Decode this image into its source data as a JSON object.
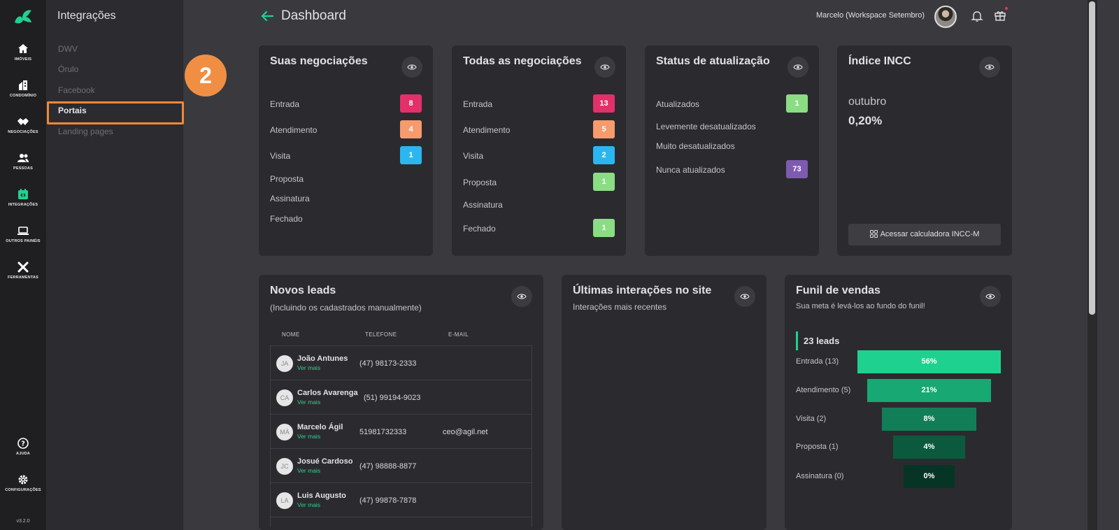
{
  "rail": {
    "items": [
      {
        "label": "IMÓVEIS",
        "icon": "home-icon"
      },
      {
        "label": "CONDOMÍNIO",
        "icon": "building-icon"
      },
      {
        "label": "NEGOCIAÇÕES",
        "icon": "handshake-icon"
      },
      {
        "label": "PESSOAS",
        "icon": "people-icon"
      },
      {
        "label": "INTEGRAÇÕES",
        "icon": "integrations-icon"
      },
      {
        "label": "OUTROS PAINÉIS",
        "icon": "laptop-icon"
      },
      {
        "label": "FERRAMENTAS",
        "icon": "tools-icon"
      },
      {
        "label": "AJUDA",
        "icon": "help-icon"
      },
      {
        "label": "CONFIGURAÇÕES",
        "icon": "gear-icon"
      }
    ],
    "version": "v3.2.0",
    "active_color": "#1fd18f"
  },
  "submenu": {
    "title": "Integrações",
    "items": [
      {
        "label": "DWV"
      },
      {
        "label": "Órulo"
      },
      {
        "label": "Facebook"
      },
      {
        "label": "Portais",
        "active": true
      },
      {
        "label": "Landing pages"
      }
    ],
    "step_badge": "2",
    "highlight_color": "#f0883a"
  },
  "header": {
    "title": "Dashboard",
    "user_name": "Marcelo (Workspace Setembro)"
  },
  "cards": {
    "suas": {
      "title": "Suas negociações",
      "rows": [
        {
          "label": "Entrada",
          "value": "8",
          "color": "#e3306a"
        },
        {
          "label": "Atendimento",
          "value": "4",
          "color": "#f59b6d"
        },
        {
          "label": "Visita",
          "value": "1",
          "color": "#2bb6f0"
        },
        {
          "label": "Proposta",
          "value": ""
        },
        {
          "label": "Assinatura",
          "value": ""
        },
        {
          "label": "Fechado",
          "value": ""
        }
      ]
    },
    "todas": {
      "title": "Todas as negociações",
      "rows": [
        {
          "label": "Entrada",
          "value": "13",
          "color": "#e3306a"
        },
        {
          "label": "Atendimento",
          "value": "5",
          "color": "#f59b6d"
        },
        {
          "label": "Visita",
          "value": "2",
          "color": "#2bb6f0"
        },
        {
          "label": "Proposta",
          "value": "1",
          "color": "#8bdd84"
        },
        {
          "label": "Assinatura",
          "value": ""
        },
        {
          "label": "Fechado",
          "value": "1",
          "color": "#8bdd84"
        }
      ]
    },
    "status": {
      "title": "Status de atualização",
      "rows": [
        {
          "label": "Atualizados",
          "value": "1",
          "color": "#8bdd84"
        },
        {
          "label": "Levemente desatualizados",
          "value": ""
        },
        {
          "label": "Muito desatualizados",
          "value": ""
        },
        {
          "label": "Nunca atualizados",
          "value": "73",
          "color": "#7d5bb0"
        }
      ]
    },
    "incc": {
      "title": "Índice INCC",
      "month": "outubro",
      "value": "0,20%",
      "button": "Acessar calculadora INCC-M"
    },
    "leads": {
      "title": "Novos leads",
      "subtitle": "(Incluindo os cadastrados manualmente)",
      "columns": [
        "NOME",
        "TELEFONE",
        "E-MAIL"
      ],
      "more_label": "Ver mais",
      "rows": [
        {
          "initials": "JA",
          "name": "João Antunes",
          "phone": "(47) 98173-2333",
          "email": ""
        },
        {
          "initials": "CA",
          "name": "Carlos Avarenga",
          "phone": "(51) 99194-9023",
          "email": ""
        },
        {
          "initials": "MÁ",
          "name": "Marcelo Ágil",
          "phone": "51981732333",
          "email": "ceo@agil.net"
        },
        {
          "initials": "JC",
          "name": "Josué Cardoso",
          "phone": "(47) 98888-8877",
          "email": ""
        },
        {
          "initials": "LA",
          "name": "Luis Augusto",
          "phone": "(47) 99878-7878",
          "email": ""
        }
      ]
    },
    "interacoes": {
      "title": "Últimas interações no site",
      "subtitle": "Interações mais recentes"
    },
    "funil": {
      "title": "Funil de vendas",
      "subtitle": "Sua meta é levá-los ao fundo do funil!",
      "total": "23 leads",
      "stages": [
        {
          "label": "Entrada (13)",
          "percent": "56%",
          "color": "#1fd18f"
        },
        {
          "label": "Atendimento (5)",
          "percent": "21%",
          "color": "#17a873"
        },
        {
          "label": "Visita (2)",
          "percent": "8%",
          "color": "#127e57"
        },
        {
          "label": "Proposta (1)",
          "percent": "4%",
          "color": "#0c5a3e"
        },
        {
          "label": "Assinatura (0)",
          "percent": "0%",
          "color": "#063525"
        }
      ]
    }
  }
}
